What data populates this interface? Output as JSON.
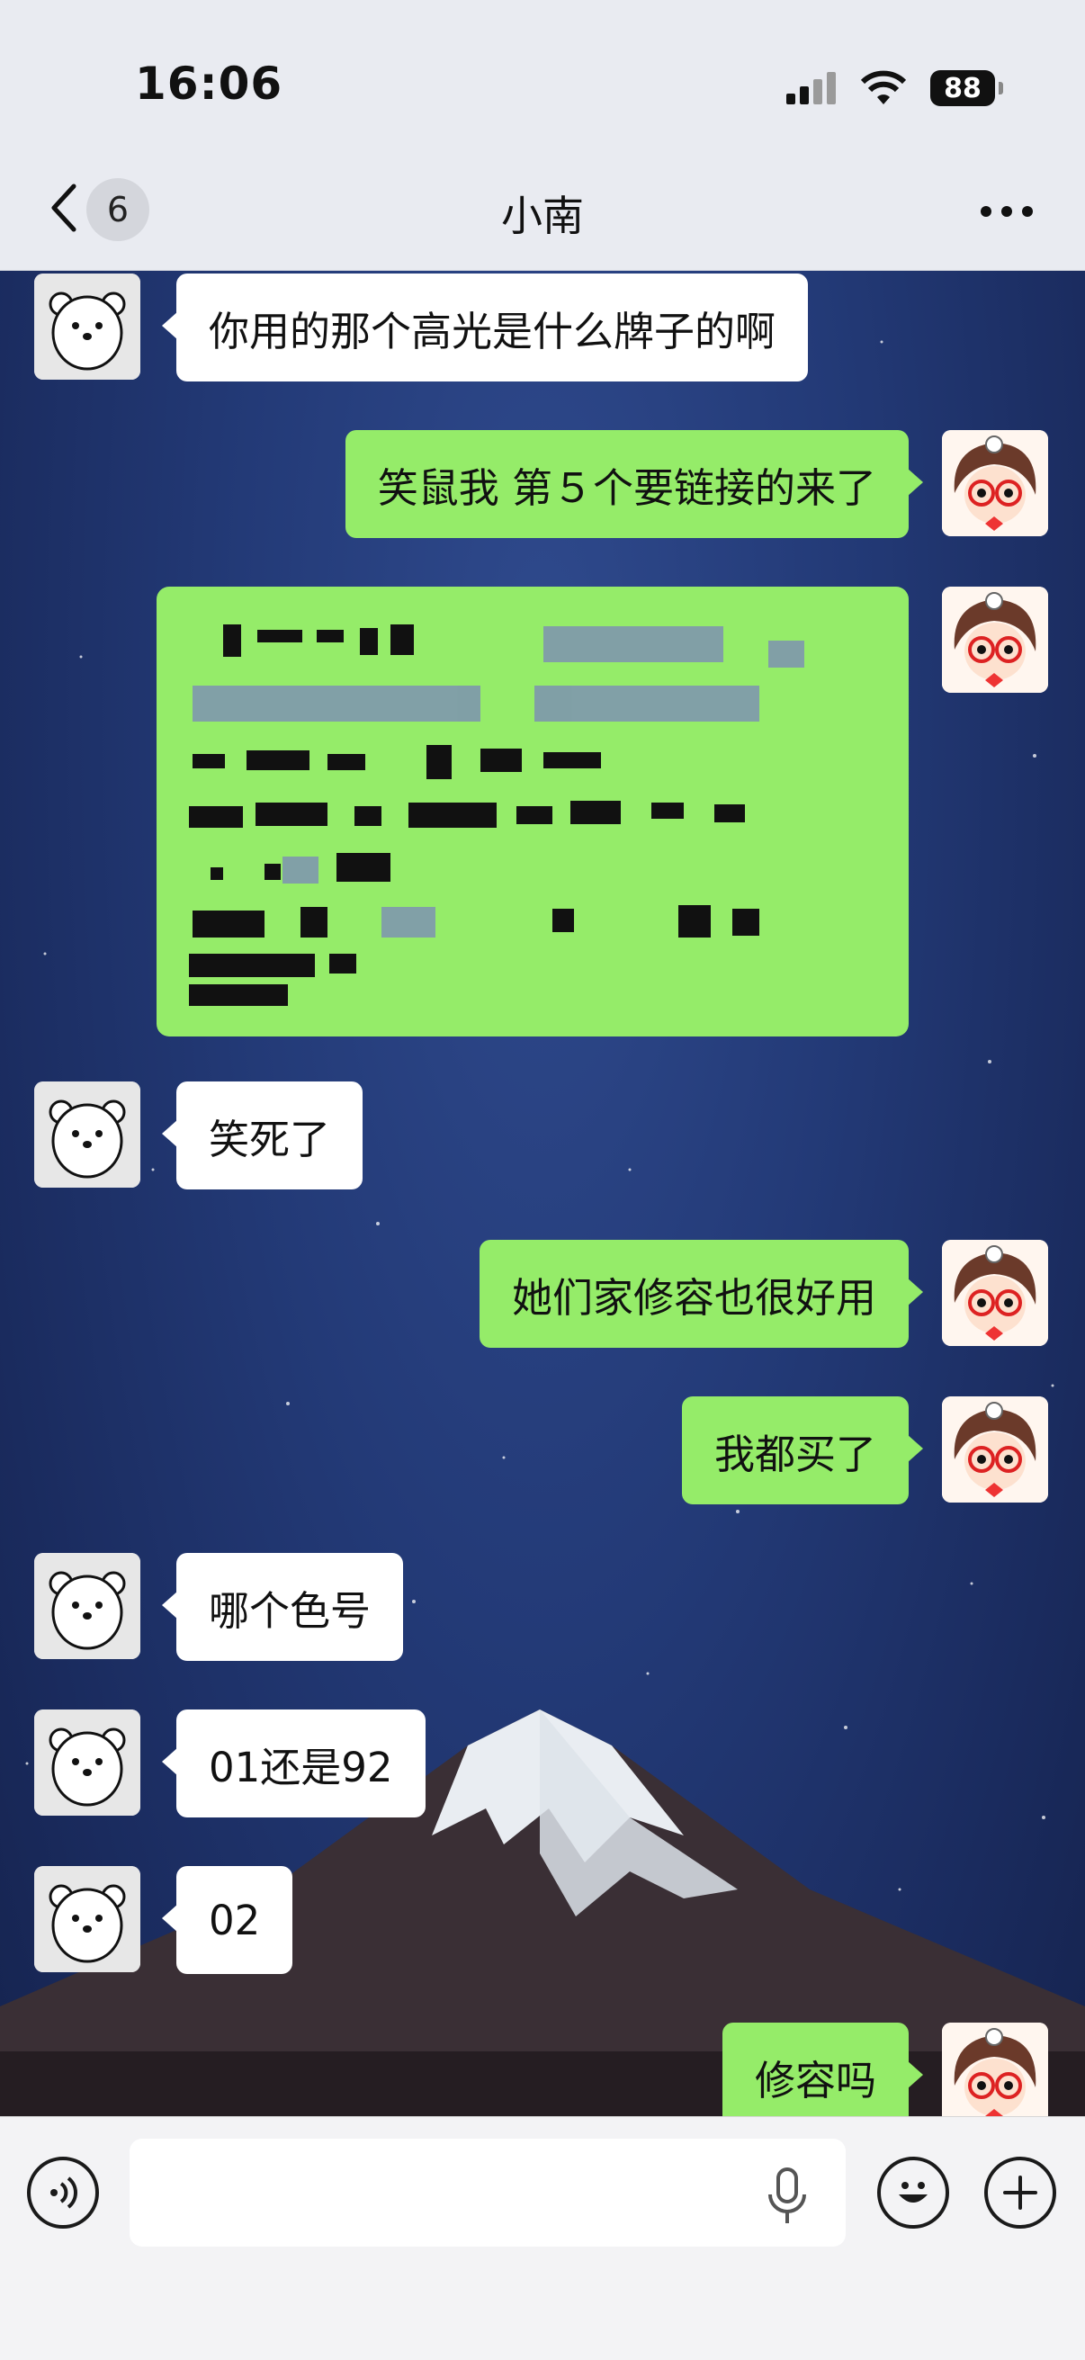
{
  "status_bar": {
    "time": "16:06",
    "battery": "88"
  },
  "header": {
    "back_count": "6",
    "title": "小南"
  },
  "messages": [
    {
      "side": "in",
      "text": "你用的那个高光是什么牌子的啊"
    },
    {
      "side": "out",
      "text": "笑鼠我 第５个要链接的来了"
    },
    {
      "side": "out",
      "text": ""
    },
    {
      "side": "in",
      "text": "笑死了"
    },
    {
      "side": "out",
      "text": "她们家修容也很好用"
    },
    {
      "side": "out",
      "text": "我都买了"
    },
    {
      "side": "in",
      "text": "哪个色号"
    },
    {
      "side": "in",
      "text": "01还是92"
    },
    {
      "side": "in",
      "text": "02"
    },
    {
      "side": "out",
      "text": "修容吗"
    }
  ],
  "colors": {
    "outgoing_bubble": "#95ec69",
    "incoming_bubble": "#ffffff",
    "header_bg": "#e9ebf1"
  },
  "icons": {
    "back": "chevron-left-icon",
    "more": "more-dots-icon",
    "voice": "voice-icon",
    "mic": "microphone-icon",
    "emoji": "emoji-icon",
    "plus": "plus-icon"
  },
  "input": {
    "value": "",
    "placeholder": ""
  }
}
